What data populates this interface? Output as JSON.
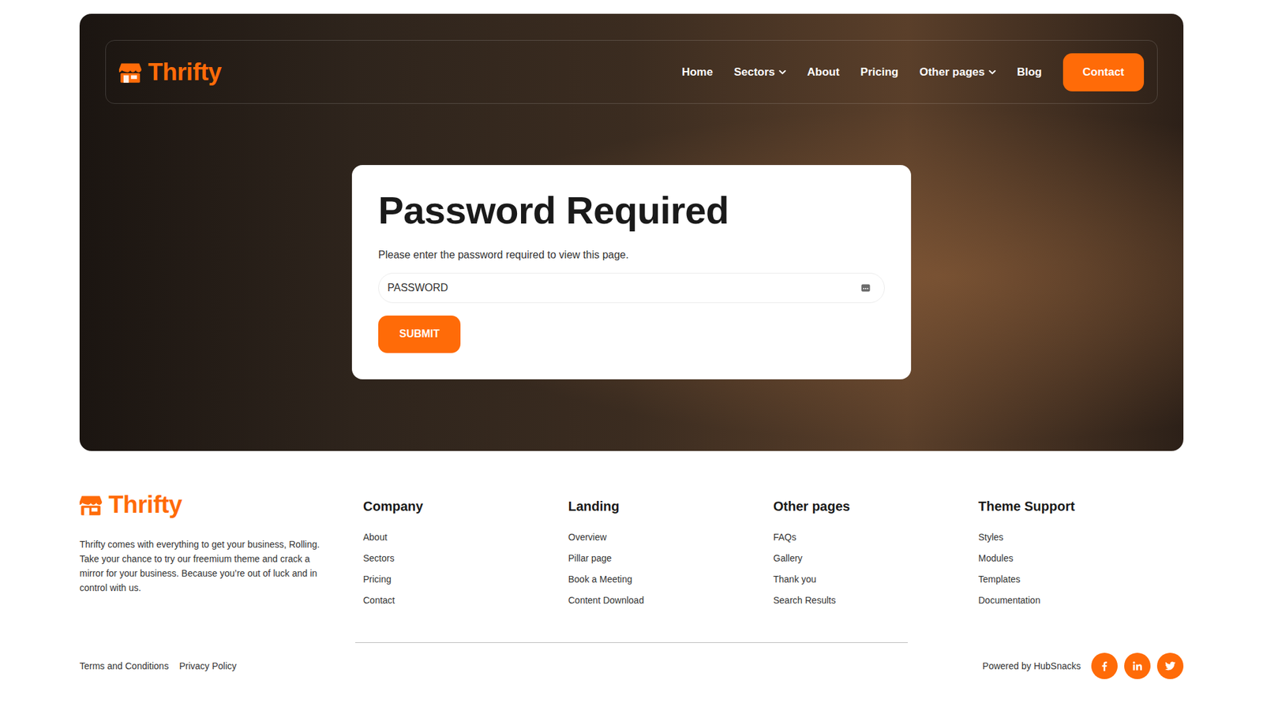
{
  "brand": {
    "name": "Thrifty"
  },
  "nav": {
    "items": [
      {
        "label": "Home",
        "dropdown": false
      },
      {
        "label": "Sectors",
        "dropdown": true
      },
      {
        "label": "About",
        "dropdown": false
      },
      {
        "label": "Pricing",
        "dropdown": false
      },
      {
        "label": "Other pages",
        "dropdown": true
      },
      {
        "label": "Blog",
        "dropdown": false
      }
    ],
    "cta": "Contact"
  },
  "password_form": {
    "title": "Password Required",
    "description": "Please enter the password required to view this page.",
    "placeholder": "PASSWORD",
    "submit": "SUBMIT"
  },
  "footer": {
    "brand": "Thrifty",
    "description": "Thrifty comes with everything to get your business, Rolling. Take your chance to try our freemium theme and crack a mirror for your business. Because you’re out of luck and in control with us.",
    "columns": [
      {
        "title": "Company",
        "links": [
          "About",
          "Sectors",
          "Pricing",
          "Contact"
        ]
      },
      {
        "title": "Landing",
        "links": [
          "Overview",
          "Pillar page",
          "Book a Meeting",
          "Content Download"
        ]
      },
      {
        "title": "Other pages",
        "links": [
          "FAQs",
          "Gallery",
          "Thank you",
          "Search Results"
        ]
      },
      {
        "title": "Theme Support",
        "links": [
          "Styles",
          "Modules",
          "Templates",
          "Documentation"
        ]
      }
    ],
    "legal": [
      "Terms and Conditions",
      "Privacy Policy"
    ],
    "powered_by": "Powered by HubSnacks"
  }
}
